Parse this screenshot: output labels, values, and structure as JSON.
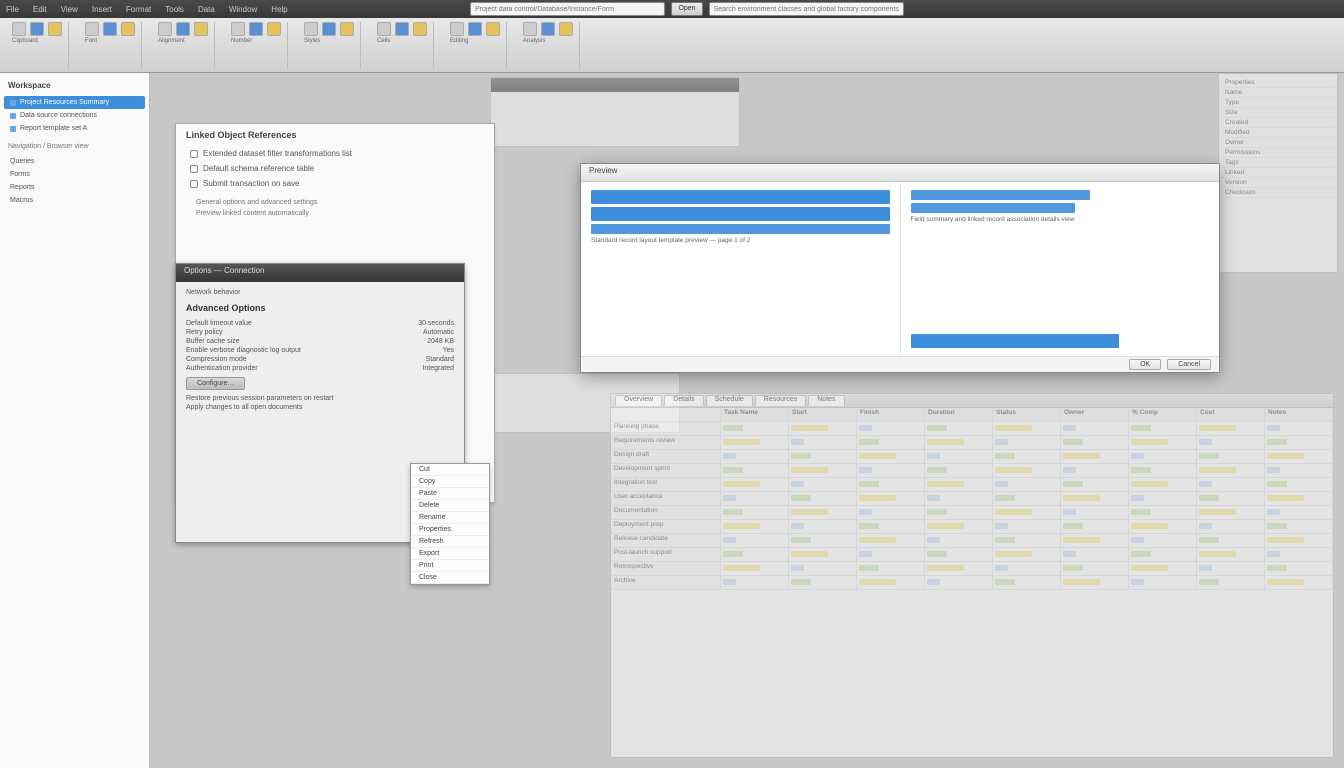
{
  "menubar": {
    "items": [
      "File",
      "Edit",
      "View",
      "Insert",
      "Format",
      "Tools",
      "Data",
      "Window",
      "Help"
    ]
  },
  "address": {
    "path_placeholder": "Project data control/Database/Instance/Form",
    "go_label": "Open",
    "search_placeholder": "Search environment classes and global factory components"
  },
  "ribbon": {
    "groups": [
      {
        "label": "Clipboard"
      },
      {
        "label": "Font"
      },
      {
        "label": "Alignment"
      },
      {
        "label": "Number"
      },
      {
        "label": "Styles"
      },
      {
        "label": "Cells"
      },
      {
        "label": "Editing"
      },
      {
        "label": "Analysis"
      }
    ]
  },
  "sidebar": {
    "header": "Workspace",
    "items": [
      {
        "label": "Project Resources Summary",
        "selected": true
      },
      {
        "label": "Data source connections"
      },
      {
        "label": "Report template set A"
      }
    ],
    "sub_header": "Navigation / Browser view",
    "sub_items": [
      {
        "label": "Queries"
      },
      {
        "label": "Forms"
      },
      {
        "label": "Reports"
      },
      {
        "label": "Macros"
      }
    ]
  },
  "doc": {
    "title": "Linked Object References",
    "items": [
      "Extended dataset filter transformations list",
      "Default schema reference table",
      "Submit transaction on save"
    ],
    "subs": [
      "General options and advanced settings",
      "Preview linked content automatically"
    ]
  },
  "dialog": {
    "title": "Options — Connection",
    "section1": "Network behavior",
    "heading": "Advanced Options",
    "rows": [
      {
        "k": "Default timeout value",
        "v": "30 seconds"
      },
      {
        "k": "Retry policy",
        "v": "Automatic"
      },
      {
        "k": "Buffer cache size",
        "v": "2048 KB"
      },
      {
        "k": "Enable verbose diagnostic log output",
        "v": "Yes"
      },
      {
        "k": "Compression mode",
        "v": "Standard"
      },
      {
        "k": "Authentication provider",
        "v": "Integrated"
      }
    ],
    "button": "Configure…",
    "footer": [
      "Restore previous session parameters on restart",
      "Apply changes to all open documents"
    ]
  },
  "ctx": {
    "items": [
      "Cut",
      "Copy",
      "Paste",
      "Delete",
      "Rename",
      "Properties",
      "Refresh",
      "Export",
      "Print",
      "Close"
    ]
  },
  "modal": {
    "title": "Preview",
    "left_caption": "Standard record layout template preview — page 1 of 2",
    "right_caption": "Field summary and linked record association details view",
    "ok": "OK",
    "cancel": "Cancel"
  },
  "sheet": {
    "tabs": [
      "Overview",
      "Details",
      "Schedule",
      "Resources",
      "Notes"
    ],
    "cols": [
      "Task Name",
      "Start",
      "Finish",
      "Duration",
      "Status",
      "Owner",
      "% Comp",
      "Cost",
      "Notes"
    ],
    "rows": [
      "Planning phase",
      "Requirements review",
      "Design draft",
      "Development sprint",
      "Integration test",
      "User acceptance",
      "Documentation",
      "Deployment prep",
      "Release candidate",
      "Post-launch support",
      "Retrospective",
      "Archive"
    ]
  },
  "inspector": {
    "rows": [
      "Properties",
      "Name",
      "Type",
      "Size",
      "Created",
      "Modified",
      "Owner",
      "Permissions",
      "Tags",
      "Linked",
      "Version",
      "Checksum"
    ]
  }
}
